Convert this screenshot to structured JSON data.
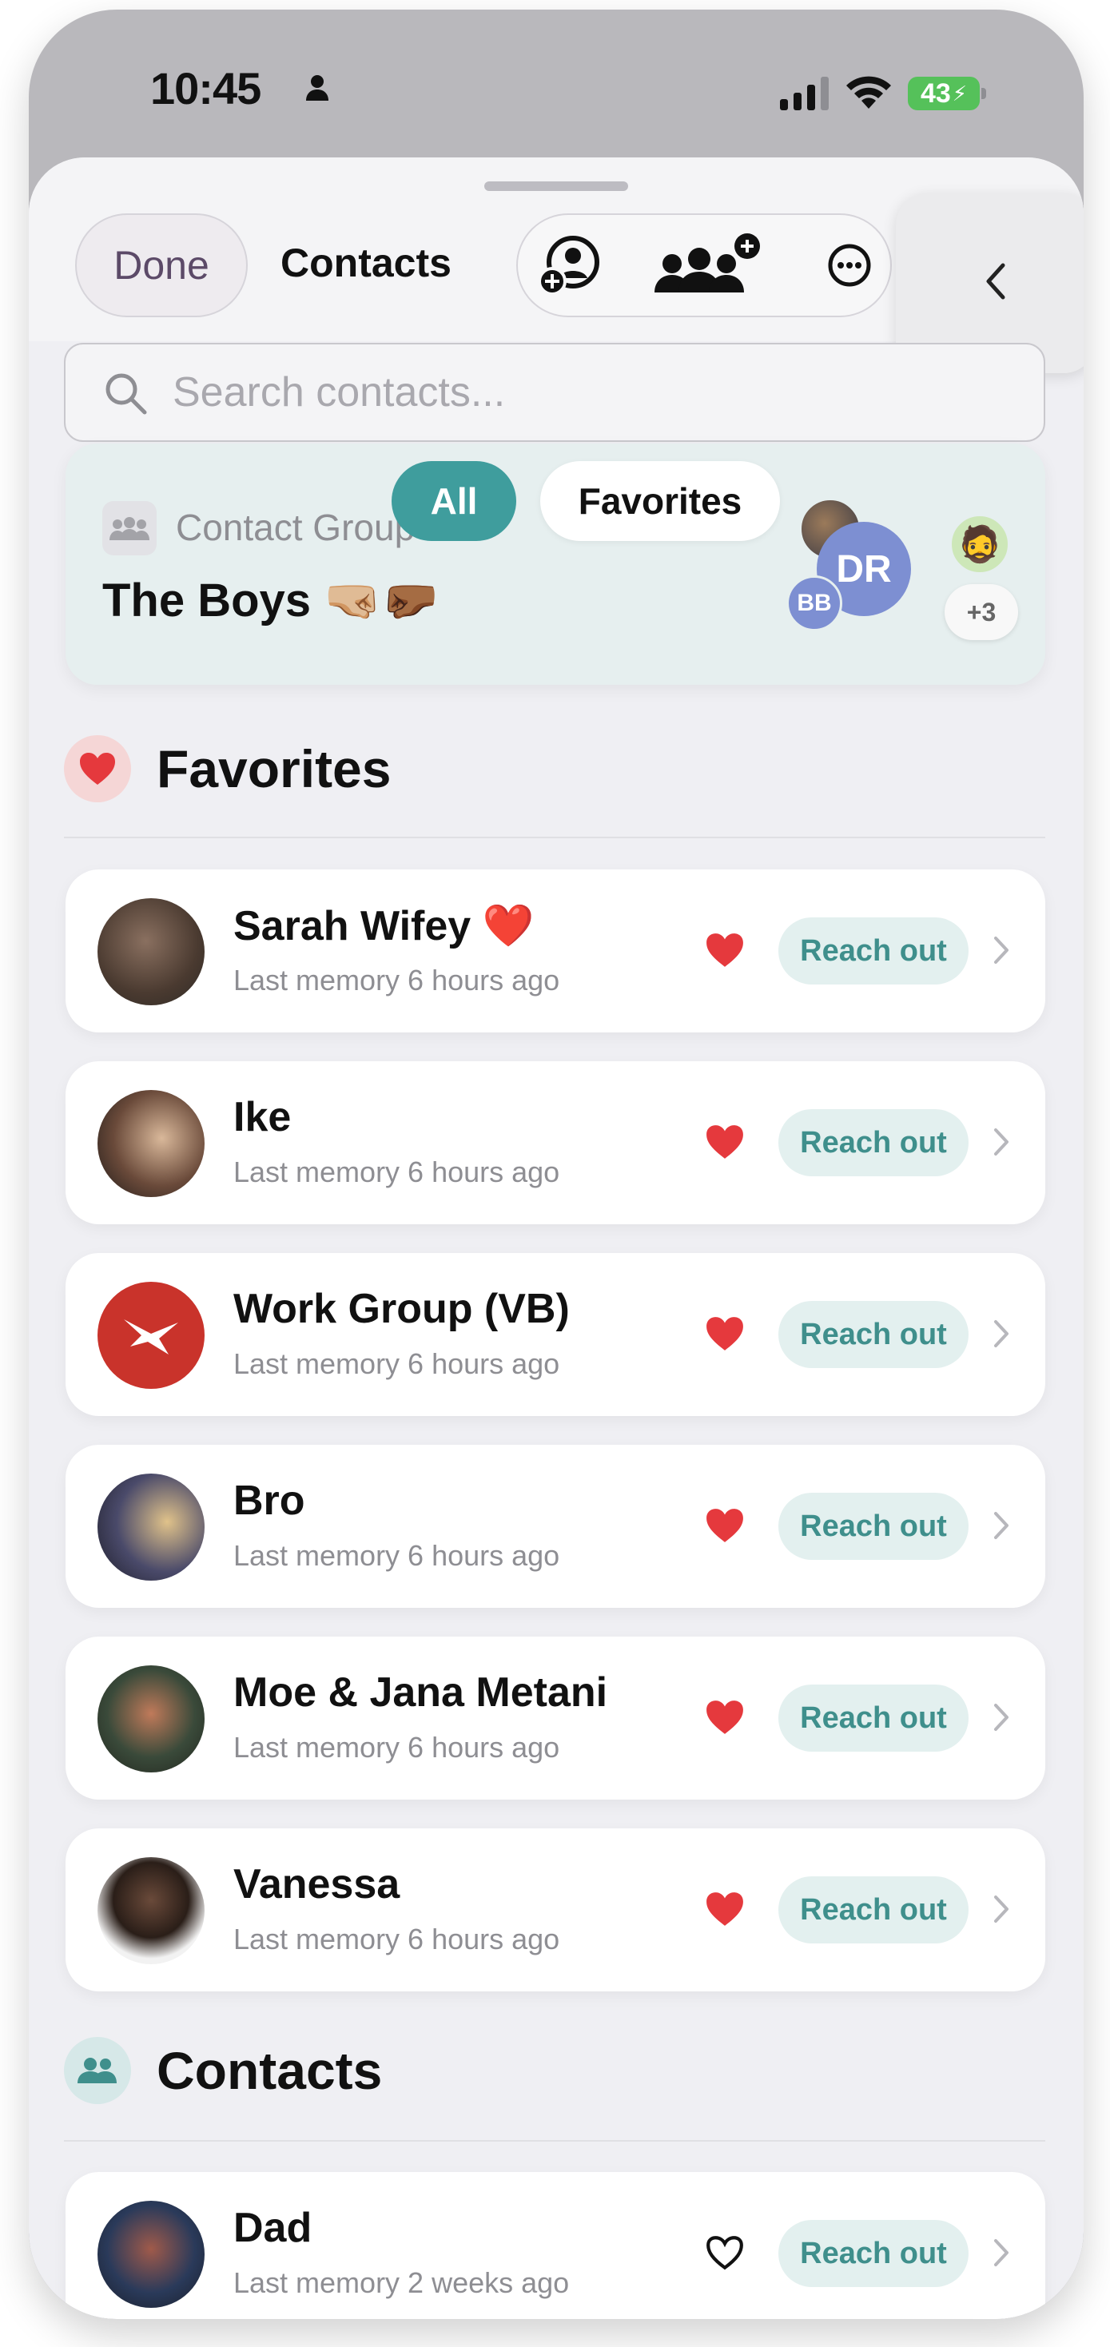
{
  "status_bar": {
    "time": "10:45",
    "battery": "43"
  },
  "header": {
    "done_label": "Done",
    "title": "Contacts"
  },
  "search": {
    "placeholder": "Search contacts..."
  },
  "filter": {
    "all_label": "All",
    "favorites_label": "Favorites"
  },
  "group_card": {
    "label": "Contact Group",
    "name": "The Boys 🤜🏼🤛🏾",
    "avatar_initials": [
      "DR",
      "BB"
    ],
    "more_count": "+3",
    "emoji_avatar": "🧔"
  },
  "sections": {
    "favorites_title": "Favorites",
    "contacts_title": "Contacts"
  },
  "favorites": [
    {
      "name": "Sarah Wifey ❤️",
      "subtitle": "Last memory 6 hours ago",
      "reach_label": "Reach out",
      "favorite": true
    },
    {
      "name": "Ike",
      "subtitle": "Last memory 6 hours ago",
      "reach_label": "Reach out",
      "favorite": true
    },
    {
      "name": "Work Group (VB)",
      "subtitle": "Last memory 6 hours ago",
      "reach_label": "Reach out",
      "favorite": true
    },
    {
      "name": "Bro",
      "subtitle": "Last memory 6 hours ago",
      "reach_label": "Reach out",
      "favorite": true
    },
    {
      "name": "Moe & Jana Metani",
      "subtitle": "Last memory 6 hours ago",
      "reach_label": "Reach out",
      "favorite": true
    },
    {
      "name": "Vanessa",
      "subtitle": "Last memory 6 hours ago",
      "reach_label": "Reach out",
      "favorite": true
    }
  ],
  "contacts": [
    {
      "name": "Dad",
      "subtitle": "Last memory 2 weeks ago",
      "reach_label": "Reach out",
      "favorite": false
    }
  ],
  "colors": {
    "accent": "#3f9d9d",
    "heart": "#e5393d",
    "reach_bg": "#e3f0ef",
    "reach_text": "#3f8f8c"
  }
}
